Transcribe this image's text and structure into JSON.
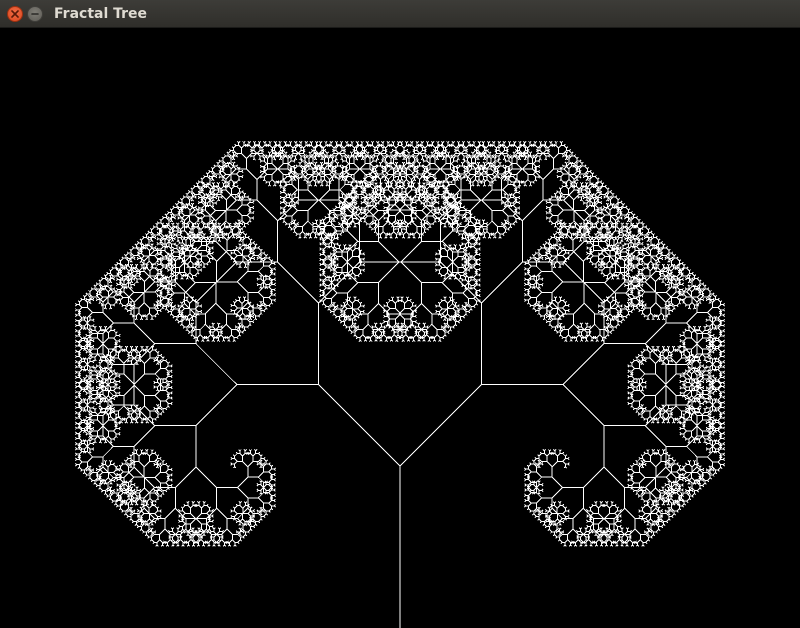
{
  "window": {
    "title": "Fractal Tree",
    "close_icon": "close-icon",
    "minimize_icon": "minimize-icon"
  },
  "canvas": {
    "background": "#000000",
    "stroke_color": "#ffffff"
  }
}
